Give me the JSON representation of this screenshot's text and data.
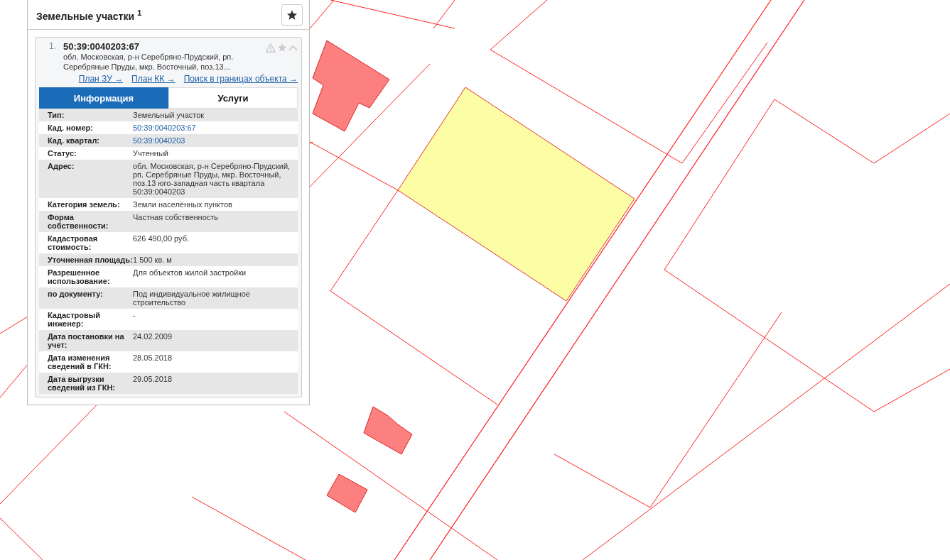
{
  "panel": {
    "title": "Земельные участки $^{1}$",
    "result": {
      "index": "1.",
      "number": "50:39:0040203:67",
      "address": "обл. Московская, р-н Серебряно-Прудский, рп. Серебряные Пруды, мкр. Восточный, поз.13...",
      "links": [
        "План ЗУ →",
        "План КК →",
        "Поиск в границах объекта →"
      ],
      "tabs": [
        {
          "label": "Информация",
          "selected": true
        },
        {
          "label": "Услуги",
          "selected": false
        }
      ],
      "rows": [
        {
          "label": "Тип:",
          "value": "Земельный участок",
          "kind": "text"
        },
        {
          "label": "Кад. номер:",
          "value": "50:39:0040203:67",
          "kind": "link"
        },
        {
          "label": "Кад. квартал:",
          "value": "50:39:0040203",
          "kind": "link"
        },
        {
          "label": "Статус:",
          "value": "Учтенный",
          "kind": "text"
        },
        {
          "label": "Адрес:",
          "value": "обл. Московская, р-н Серебряно-Прудский, рп. Серебряные Пруды, мкр. Восточный, поз.13 юго-западная часть квартала 50:39:0040203",
          "kind": "text"
        },
        {
          "label": "Категория земель:",
          "value": "Земли населённых пунктов",
          "kind": "text"
        },
        {
          "label": "Форма собственности:",
          "value": "Частная собственность",
          "kind": "text"
        },
        {
          "label": "Кадастровая стоимость:",
          "value": "626 490,00 руб.",
          "kind": "text"
        },
        {
          "label": "Уточненная площадь:",
          "value": "1 500 кв. м",
          "kind": "text"
        },
        {
          "label": "Разрешенное использование:",
          "value": "Для объектов жилой застройки",
          "kind": "text"
        },
        {
          "label": "по документу:",
          "value": "Под индивидуальное жилищное строительство",
          "kind": "text"
        },
        {
          "label": "Кадастровый инженер:",
          "value": "-",
          "kind": "text"
        },
        {
          "label": "Дата постановки на учет:",
          "value": "24.02.2009",
          "kind": "text"
        },
        {
          "label": "Дата изменения сведений в ГКН:",
          "value": "28.05.2018",
          "kind": "text"
        },
        {
          "label": "Дата выгрузки сведений из ГКН:",
          "value": "29.05.2018",
          "kind": "text"
        }
      ]
    }
  }
}
